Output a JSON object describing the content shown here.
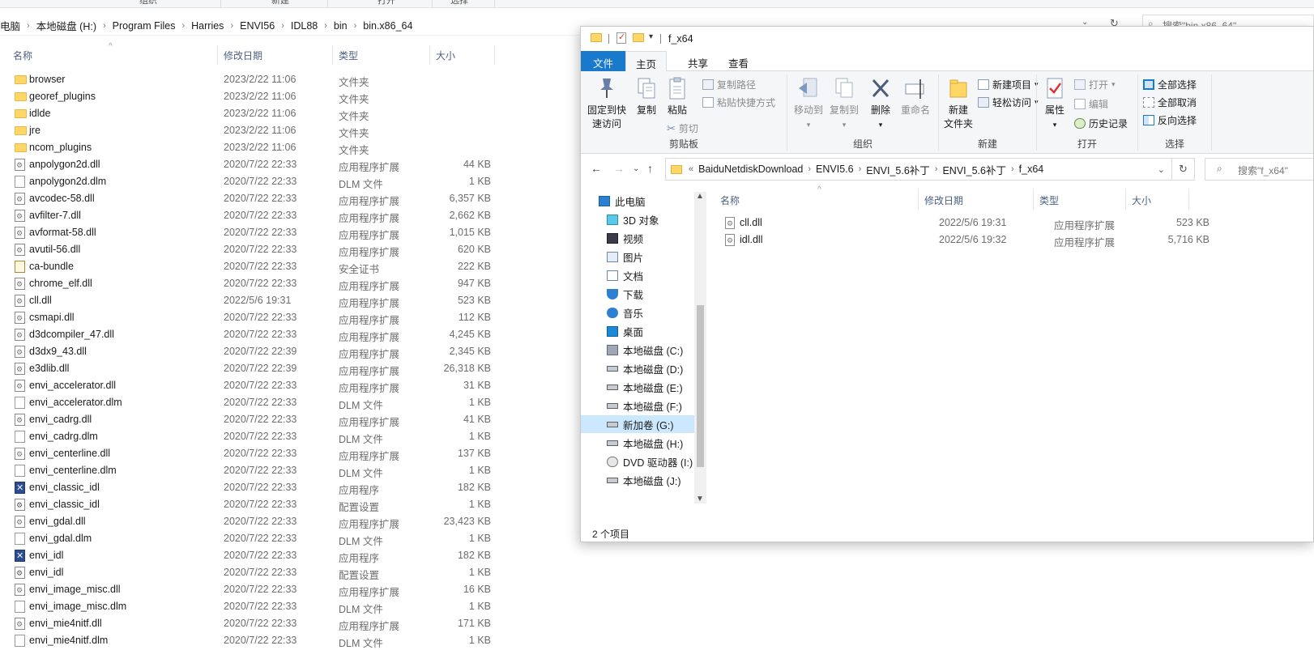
{
  "background_window": {
    "ribbon_groups": [
      "组织",
      "新建",
      "打开",
      "选择"
    ],
    "breadcrumb": [
      "电脑",
      "本地磁盘 (H:)",
      "Program Files",
      "Harries",
      "ENVI56",
      "IDL88",
      "bin",
      "bin.x86_64"
    ],
    "search_placeholder": "搜索\"bin.x86_64\"",
    "columns": [
      "名称",
      "修改日期",
      "类型",
      "大小"
    ],
    "rows": [
      {
        "name": "browser",
        "date": "2023/2/22 11:06",
        "type": "文件夹",
        "size": "",
        "icon": "folder"
      },
      {
        "name": "georef_plugins",
        "date": "2023/2/22 11:06",
        "type": "文件夹",
        "size": "",
        "icon": "folder"
      },
      {
        "name": "idlde",
        "date": "2023/2/22 11:06",
        "type": "文件夹",
        "size": "",
        "icon": "folder"
      },
      {
        "name": "jre",
        "date": "2023/2/22 11:06",
        "type": "文件夹",
        "size": "",
        "icon": "folder"
      },
      {
        "name": "ncom_plugins",
        "date": "2023/2/22 11:06",
        "type": "文件夹",
        "size": "",
        "icon": "folder"
      },
      {
        "name": "anpolygon2d.dll",
        "date": "2020/7/22 22:33",
        "type": "应用程序扩展",
        "size": "44 KB",
        "icon": "dll"
      },
      {
        "name": "anpolygon2d.dlm",
        "date": "2020/7/22 22:33",
        "type": "DLM 文件",
        "size": "1 KB",
        "icon": "file"
      },
      {
        "name": "avcodec-58.dll",
        "date": "2020/7/22 22:33",
        "type": "应用程序扩展",
        "size": "6,357 KB",
        "icon": "dll"
      },
      {
        "name": "avfilter-7.dll",
        "date": "2020/7/22 22:33",
        "type": "应用程序扩展",
        "size": "2,662 KB",
        "icon": "dll"
      },
      {
        "name": "avformat-58.dll",
        "date": "2020/7/22 22:33",
        "type": "应用程序扩展",
        "size": "1,015 KB",
        "icon": "dll"
      },
      {
        "name": "avutil-56.dll",
        "date": "2020/7/22 22:33",
        "type": "应用程序扩展",
        "size": "620 KB",
        "icon": "dll"
      },
      {
        "name": "ca-bundle",
        "date": "2020/7/22 22:33",
        "type": "安全证书",
        "size": "222 KB",
        "icon": "cert"
      },
      {
        "name": "chrome_elf.dll",
        "date": "2020/7/22 22:33",
        "type": "应用程序扩展",
        "size": "947 KB",
        "icon": "dll"
      },
      {
        "name": "cll.dll",
        "date": "2022/5/6 19:31",
        "type": "应用程序扩展",
        "size": "523 KB",
        "icon": "dll"
      },
      {
        "name": "csmapi.dll",
        "date": "2020/7/22 22:33",
        "type": "应用程序扩展",
        "size": "112 KB",
        "icon": "dll"
      },
      {
        "name": "d3dcompiler_47.dll",
        "date": "2020/7/22 22:33",
        "type": "应用程序扩展",
        "size": "4,245 KB",
        "icon": "dll"
      },
      {
        "name": "d3dx9_43.dll",
        "date": "2020/7/22 22:39",
        "type": "应用程序扩展",
        "size": "2,345 KB",
        "icon": "dll"
      },
      {
        "name": "e3dlib.dll",
        "date": "2020/7/22 22:39",
        "type": "应用程序扩展",
        "size": "26,318 KB",
        "icon": "dll"
      },
      {
        "name": "envi_accelerator.dll",
        "date": "2020/7/22 22:33",
        "type": "应用程序扩展",
        "size": "31 KB",
        "icon": "dll"
      },
      {
        "name": "envi_accelerator.dlm",
        "date": "2020/7/22 22:33",
        "type": "DLM 文件",
        "size": "1 KB",
        "icon": "file"
      },
      {
        "name": "envi_cadrg.dll",
        "date": "2020/7/22 22:33",
        "type": "应用程序扩展",
        "size": "41 KB",
        "icon": "dll"
      },
      {
        "name": "envi_cadrg.dlm",
        "date": "2020/7/22 22:33",
        "type": "DLM 文件",
        "size": "1 KB",
        "icon": "file"
      },
      {
        "name": "envi_centerline.dll",
        "date": "2020/7/22 22:33",
        "type": "应用程序扩展",
        "size": "137 KB",
        "icon": "dll"
      },
      {
        "name": "envi_centerline.dlm",
        "date": "2020/7/22 22:33",
        "type": "DLM 文件",
        "size": "1 KB",
        "icon": "file"
      },
      {
        "name": "envi_classic_idl",
        "date": "2020/7/22 22:33",
        "type": "应用程序",
        "size": "182 KB",
        "icon": "exe"
      },
      {
        "name": "envi_classic_idl",
        "date": "2020/7/22 22:33",
        "type": "配置设置",
        "size": "1 KB",
        "icon": "cfg"
      },
      {
        "name": "envi_gdal.dll",
        "date": "2020/7/22 22:33",
        "type": "应用程序扩展",
        "size": "23,423 KB",
        "icon": "dll"
      },
      {
        "name": "envi_gdal.dlm",
        "date": "2020/7/22 22:33",
        "type": "DLM 文件",
        "size": "1 KB",
        "icon": "file"
      },
      {
        "name": "envi_idl",
        "date": "2020/7/22 22:33",
        "type": "应用程序",
        "size": "182 KB",
        "icon": "exe"
      },
      {
        "name": "envi_idl",
        "date": "2020/7/22 22:33",
        "type": "配置设置",
        "size": "1 KB",
        "icon": "cfg"
      },
      {
        "name": "envi_image_misc.dll",
        "date": "2020/7/22 22:33",
        "type": "应用程序扩展",
        "size": "16 KB",
        "icon": "dll"
      },
      {
        "name": "envi_image_misc.dlm",
        "date": "2020/7/22 22:33",
        "type": "DLM 文件",
        "size": "1 KB",
        "icon": "file"
      },
      {
        "name": "envi_mie4nitf.dll",
        "date": "2020/7/22 22:33",
        "type": "应用程序扩展",
        "size": "171 KB",
        "icon": "dll"
      },
      {
        "name": "envi_mie4nitf.dlm",
        "date": "2020/7/22 22:33",
        "type": "DLM 文件",
        "size": "1 KB",
        "icon": "file"
      }
    ]
  },
  "foreground_window": {
    "title": "f_x64",
    "tabs": {
      "file": "文件",
      "home": "主页",
      "share": "共享",
      "view": "查看"
    },
    "ribbon": {
      "clipboard": {
        "pin": "固定到快\n速访问",
        "copy": "复制",
        "paste": "粘贴",
        "copy_path": "复制路径",
        "paste_shortcut": "粘贴快捷方式",
        "cut": "剪切",
        "label": "剪贴板"
      },
      "organize": {
        "move_to": "移动到",
        "copy_to": "复制到",
        "delete": "删除",
        "rename": "重命名",
        "label": "组织"
      },
      "new": {
        "new_folder": "新建\n文件夹",
        "new_item": "新建项目",
        "easy_access": "轻松访问",
        "label": "新建"
      },
      "open": {
        "properties": "属性",
        "open": "打开",
        "edit": "编辑",
        "history": "历史记录",
        "label": "打开"
      },
      "select": {
        "select_all": "全部选择",
        "select_none": "全部取消",
        "invert": "反向选择",
        "label": "选择"
      }
    },
    "breadcrumb": [
      "BaiduNetdiskDownload",
      "ENVI5.6",
      "ENVI_5.6补丁",
      "ENVI_5.6补丁",
      "f_x64"
    ],
    "breadcrumb_prefix": "«",
    "search_placeholder": "搜索\"f_x64\"",
    "tree": [
      {
        "label": "此电脑",
        "icon": "pc"
      },
      {
        "label": "3D 对象",
        "icon": "cube"
      },
      {
        "label": "视频",
        "icon": "video"
      },
      {
        "label": "图片",
        "icon": "pictures"
      },
      {
        "label": "文档",
        "icon": "documents"
      },
      {
        "label": "下载",
        "icon": "download"
      },
      {
        "label": "音乐",
        "icon": "music"
      },
      {
        "label": "桌面",
        "icon": "desktop"
      },
      {
        "label": "本地磁盘 (C:)",
        "icon": "drive-c"
      },
      {
        "label": "本地磁盘 (D:)",
        "icon": "drive"
      },
      {
        "label": "本地磁盘 (E:)",
        "icon": "drive"
      },
      {
        "label": "本地磁盘 (F:)",
        "icon": "drive"
      },
      {
        "label": "新加卷 (G:)",
        "icon": "drive",
        "selected": true
      },
      {
        "label": "本地磁盘 (H:)",
        "icon": "drive"
      },
      {
        "label": "DVD 驱动器 (I:)",
        "icon": "dvd"
      },
      {
        "label": "本地磁盘 (J:)",
        "icon": "drive"
      }
    ],
    "columns": [
      "名称",
      "修改日期",
      "类型",
      "大小"
    ],
    "rows": [
      {
        "name": "cll.dll",
        "date": "2022/5/6 19:31",
        "type": "应用程序扩展",
        "size": "523 KB"
      },
      {
        "name": "idl.dll",
        "date": "2022/5/6 19:32",
        "type": "应用程序扩展",
        "size": "5,716 KB"
      }
    ],
    "status": "2 个项目"
  },
  "colors": {
    "accent": "#1979ca",
    "selected": "#cce8ff",
    "folder": "#ffd766",
    "header_text": "#4d6082"
  }
}
